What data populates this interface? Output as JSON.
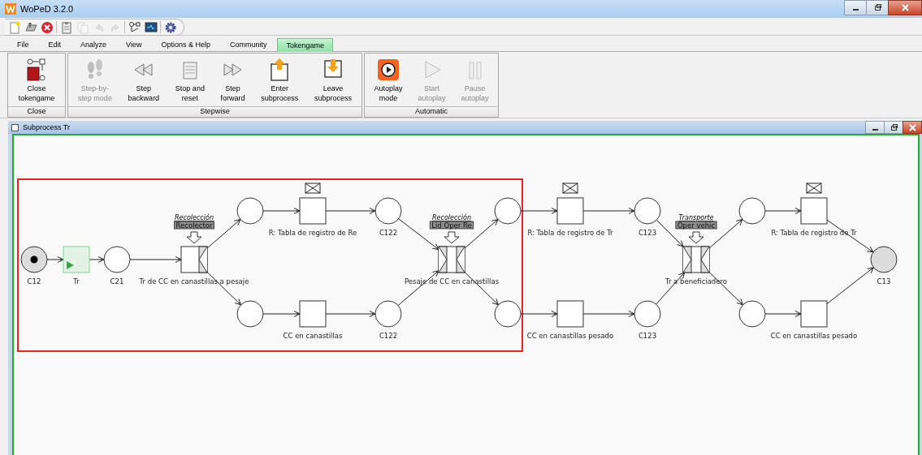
{
  "window": {
    "title": "WoPeD 3.2.0"
  },
  "quick_toolbar": [
    {
      "kind": "new",
      "disabled": false
    },
    {
      "kind": "open",
      "disabled": false
    },
    {
      "kind": "close",
      "disabled": false
    },
    {
      "kind": "clipboard",
      "disabled": false
    },
    {
      "kind": "copy",
      "disabled": true
    },
    {
      "kind": "undo",
      "disabled": true
    },
    {
      "kind": "redo",
      "disabled": true
    },
    {
      "kind": "net",
      "disabled": false
    },
    {
      "kind": "monitor",
      "disabled": false
    },
    {
      "kind": "gear",
      "disabled": false
    }
  ],
  "tabs": [
    {
      "label": "File",
      "selected": false
    },
    {
      "label": "Edit",
      "selected": false
    },
    {
      "label": "Analyze",
      "selected": false
    },
    {
      "label": "View",
      "selected": false
    },
    {
      "label": "Options & Help",
      "selected": false
    },
    {
      "label": "Community",
      "selected": false
    },
    {
      "label": "Tokengame",
      "selected": true
    }
  ],
  "ribbon": {
    "groups": [
      {
        "title": "Close",
        "buttons": [
          {
            "kind": "close-tokengame",
            "label": [
              "Close",
              "tokengame"
            ],
            "disabled": false
          }
        ]
      },
      {
        "title": "Stepwise",
        "buttons": [
          {
            "kind": "step-mode",
            "label": [
              "Step-by-",
              "step mode"
            ],
            "disabled": true
          },
          {
            "kind": "step-backward",
            "label": [
              "Step",
              "backward"
            ],
            "disabled": false
          },
          {
            "kind": "stop-reset",
            "label": [
              "Stop and",
              "reset"
            ],
            "disabled": false
          },
          {
            "kind": "step-forward",
            "label": [
              "Step",
              "forward"
            ],
            "disabled": false
          },
          {
            "kind": "enter-subprocess",
            "label": [
              "Enter",
              "subprocess"
            ],
            "disabled": false
          },
          {
            "kind": "leave-subprocess",
            "label": [
              "Leave",
              "subprocess"
            ],
            "disabled": false
          }
        ]
      },
      {
        "title": "Automatic",
        "buttons": [
          {
            "kind": "autoplay-mode",
            "label": [
              "Autoplay",
              "mode"
            ],
            "disabled": false
          },
          {
            "kind": "start-autoplay",
            "label": [
              "Start",
              "autoplay"
            ],
            "disabled": true
          },
          {
            "kind": "pause-autoplay",
            "label": [
              "Pause",
              "autoplay"
            ],
            "disabled": true
          }
        ]
      }
    ]
  },
  "subprocess_window": {
    "title": "Subprocess Tr"
  },
  "net": {
    "nodes": [
      {
        "kind": "place",
        "label": "C12",
        "marked": true,
        "highlighted": true
      },
      {
        "kind": "transition",
        "label": "Tr",
        "enabled": true
      },
      {
        "kind": "place",
        "label": "C21",
        "marked": false,
        "highlighted": false
      },
      {
        "kind": "and-split",
        "label": "Tr de CC en canastillas a pesaje",
        "resource": {
          "role": "Recolección",
          "group": "Recolector"
        }
      },
      {
        "kind": "place",
        "marked": false,
        "highlighted": false
      },
      {
        "kind": "place",
        "marked": false,
        "highlighted": false
      },
      {
        "kind": "transition",
        "label": "R: Tabla de registro de Re",
        "enabled": false,
        "message_trigger": true
      },
      {
        "kind": "transition",
        "label": "CC en canastillas",
        "enabled": false
      },
      {
        "kind": "place",
        "label": "C122",
        "marked": false,
        "highlighted": false
      },
      {
        "kind": "place",
        "label": "C122",
        "marked": false,
        "highlighted": false
      },
      {
        "kind": "and-join-split",
        "label": "Pesaje de CC en canastillas",
        "resource": {
          "role": "Recolección",
          "group": "Lid Oper Re"
        }
      },
      {
        "kind": "place",
        "marked": false,
        "highlighted": false
      },
      {
        "kind": "place",
        "marked": false,
        "highlighted": false
      },
      {
        "kind": "transition",
        "label": "R: Tabla de registro de Tr",
        "enabled": false,
        "message_trigger": true
      },
      {
        "kind": "transition",
        "label": "CC en canastillas pesado",
        "enabled": false
      },
      {
        "kind": "place",
        "label": "C123",
        "marked": false,
        "highlighted": false
      },
      {
        "kind": "place",
        "label": "C123",
        "marked": false,
        "highlighted": false
      },
      {
        "kind": "and-join-split",
        "label": "Tr a beneficiadero",
        "resource": {
          "role": "Transporte",
          "group": "Oper vehic"
        }
      },
      {
        "kind": "place",
        "marked": false,
        "highlighted": false
      },
      {
        "kind": "place",
        "marked": false,
        "highlighted": false
      },
      {
        "kind": "transition",
        "label": "R: Tabla de registro de Tr",
        "enabled": false,
        "message_trigger": true
      },
      {
        "kind": "transition",
        "label": "CC en canastillas pesado",
        "enabled": false
      },
      {
        "kind": "place",
        "label": "C13",
        "marked": false,
        "highlighted": true
      }
    ]
  }
}
